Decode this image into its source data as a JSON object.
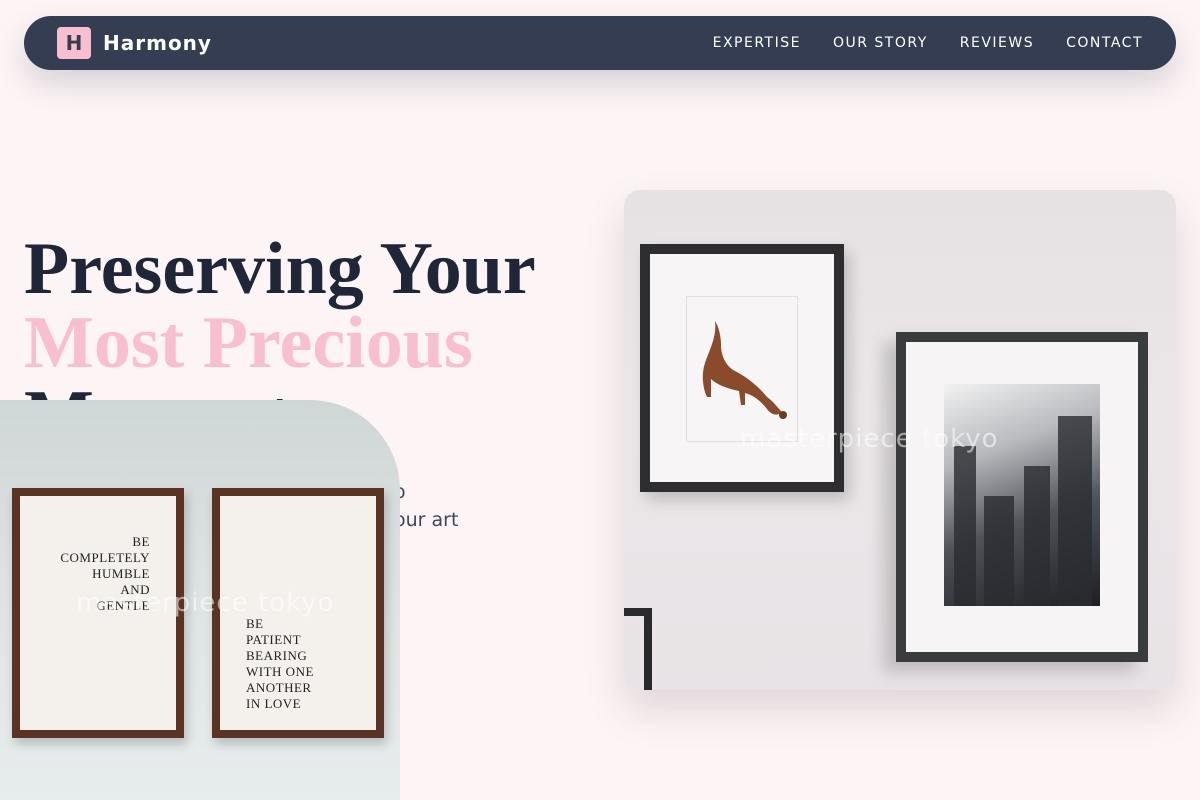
{
  "brand": {
    "mark": "H",
    "name": "Harmony"
  },
  "nav": {
    "items": [
      {
        "label": "EXPERTISE"
      },
      {
        "label": "OUR STORY"
      },
      {
        "label": "REVIEWS"
      },
      {
        "label": "CONTACT"
      }
    ]
  },
  "hero": {
    "title_line1": "Preserving Your",
    "title_line2": "Most Precious",
    "title_line3": "Moments",
    "subtitle_line1": "o",
    "subtitle_line2": "our art"
  },
  "images": {
    "right_watermark": "masterpiece tokyo",
    "left_watermark": "masterpiece tokyo",
    "quote_one": [
      "BE",
      "COMPLETELY",
      "HUMBLE",
      "AND",
      "GENTLE"
    ],
    "quote_two": [
      "BE",
      "PATIENT",
      "BEARING",
      "WITH ONE",
      "ANOTHER",
      "IN LOVE"
    ]
  },
  "colors": {
    "background": "#fdf4f5",
    "navbar": "#343d52",
    "accent_pink": "#f8bfd0",
    "heading_dark": "#1f2638"
  }
}
